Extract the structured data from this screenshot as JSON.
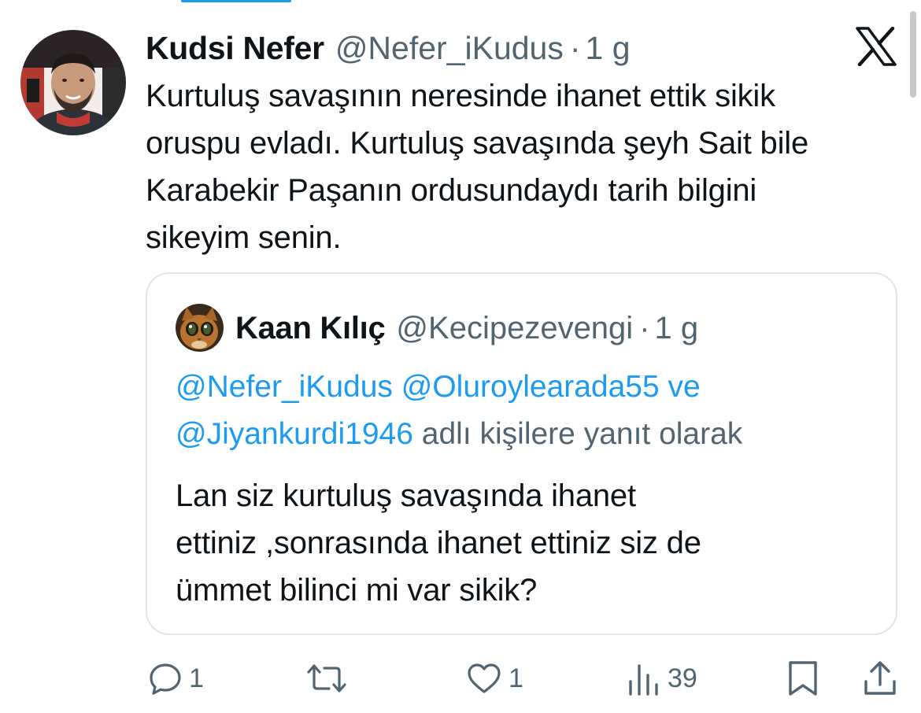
{
  "tweet": {
    "display_name": "Kudsi Nefer",
    "handle": "@Nefer_iKudus",
    "separator": "·",
    "time": "1 g",
    "text_lines": [
      "Kurtuluş savaşının neresinde ihanet ettik sikik",
      "oruspu evladı. Kurtuluş savaşında şeyh Sait bile",
      "Karabekir Paşanın ordusundaydı tarih bilgini",
      "sikeyim senin."
    ]
  },
  "quoted_tweet": {
    "display_name": "Kaan Kılıç",
    "handle": "@Kecipezevengi",
    "separator": "·",
    "time": "1 g",
    "reply_context": {
      "mention_1": "@Nefer_iKudus",
      "mention_2": "@Oluroylearada55",
      "conjunction": "ve",
      "mention_3": "@Jiyankurdi1946",
      "suffix": "adlı kişilere yanıt olarak"
    },
    "text_lines": [
      "Lan siz kurtuluş savaşında ihanet",
      "ettiniz ,sonrasında ihanet ettiniz siz de",
      "ümmet bilinci mi var sikik?"
    ]
  },
  "actions": {
    "reply_count": "1",
    "retweet_count": "",
    "like_count": "1",
    "views_count": "39"
  },
  "icons": [
    "x-logo-icon",
    "reply-icon",
    "retweet-icon",
    "like-icon",
    "views-icon",
    "bookmark-icon",
    "share-icon"
  ],
  "colors": {
    "text_primary": "#0f1419",
    "text_secondary": "#536471",
    "link": "#1d9bf0",
    "card_border": "#e1e5e9"
  }
}
